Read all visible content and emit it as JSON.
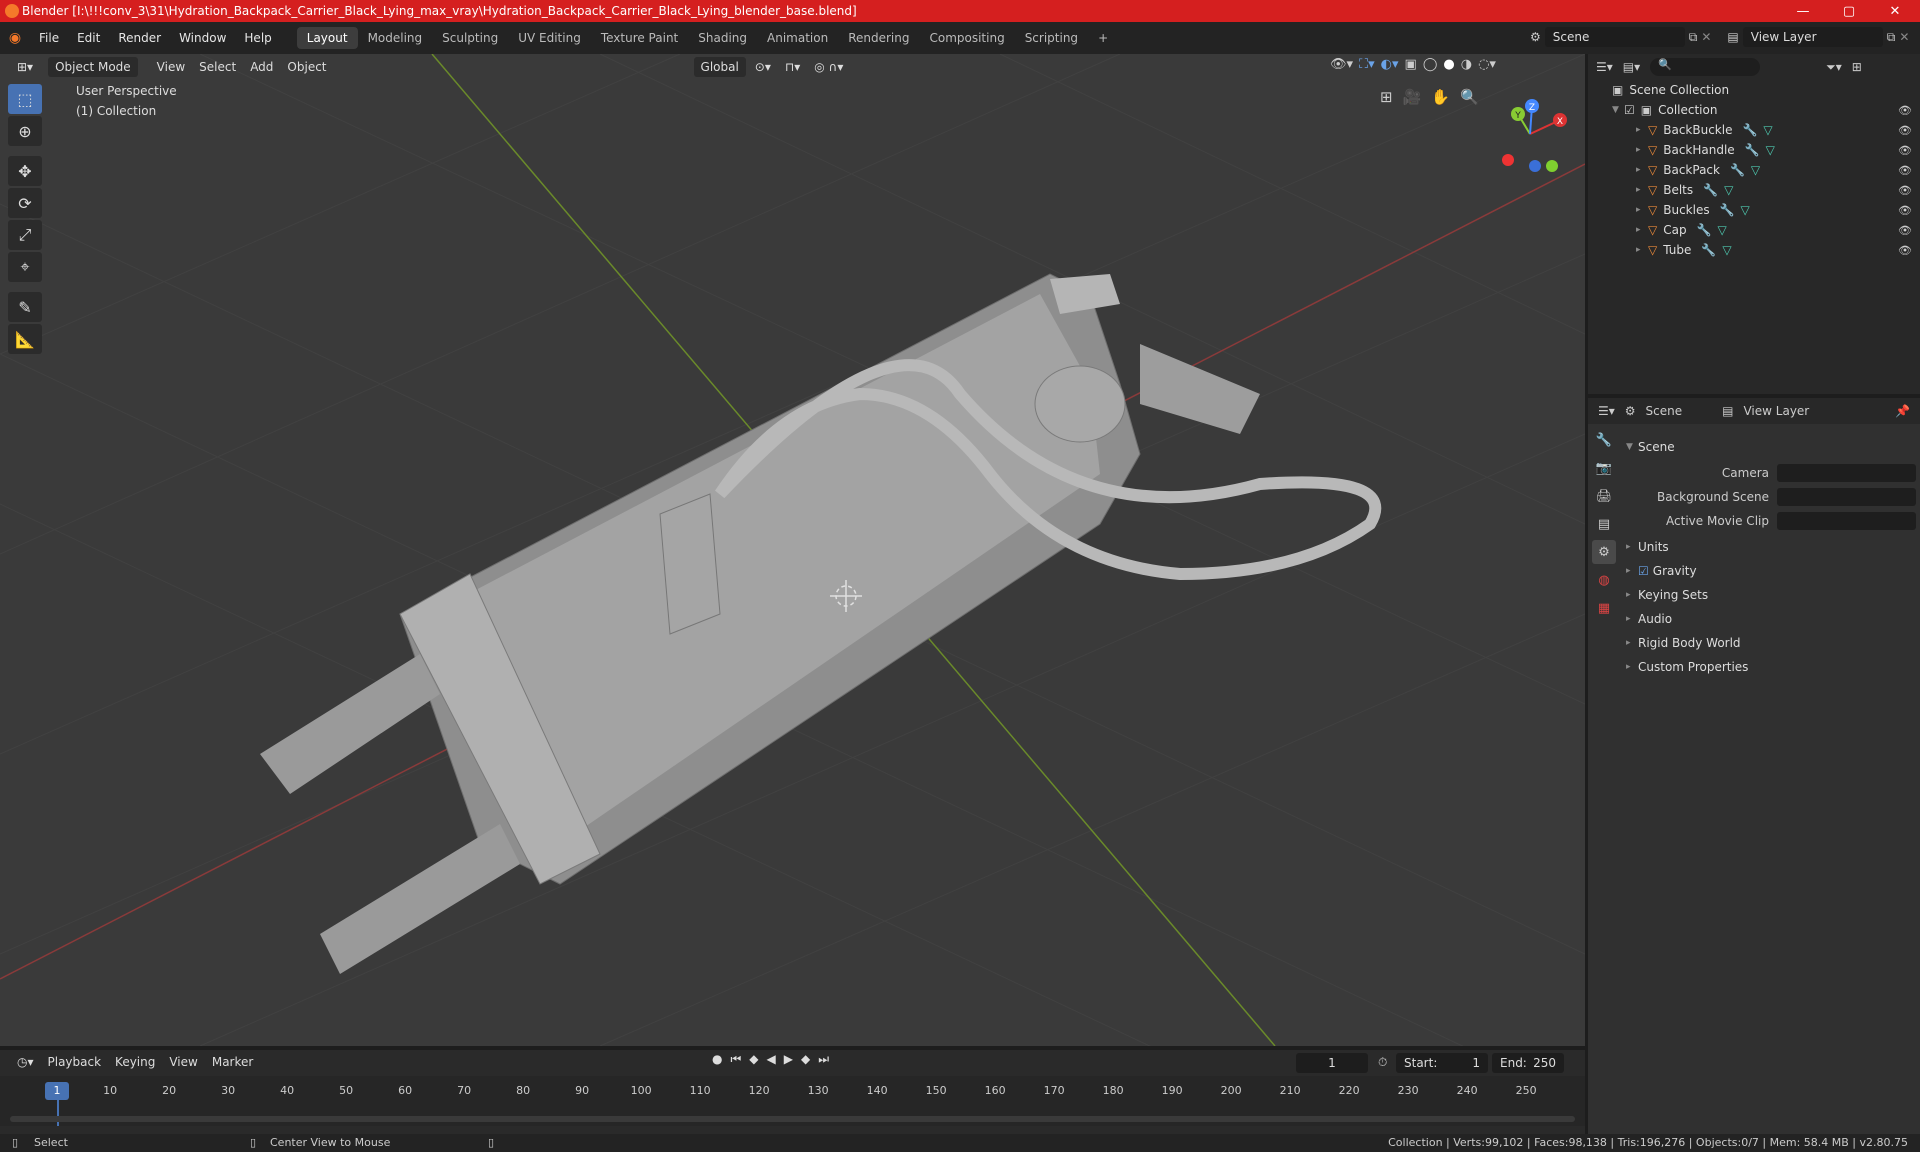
{
  "window": {
    "title": "Blender [I:\\!!!conv_3\\31\\Hydration_Backpack_Carrier_Black_Lying_max_vray\\Hydration_Backpack_Carrier_Black_Lying_blender_base.blend]",
    "min": "—",
    "max": "▢",
    "close": "✕"
  },
  "menus": [
    "File",
    "Edit",
    "Render",
    "Window",
    "Help"
  ],
  "workspaces": [
    "Layout",
    "Modeling",
    "Sculpting",
    "UV Editing",
    "Texture Paint",
    "Shading",
    "Animation",
    "Rendering",
    "Compositing",
    "Scripting"
  ],
  "scene_field": "Scene",
  "view_layer_field": "View Layer",
  "viewport": {
    "mode": "Object Mode",
    "menus": [
      "View",
      "Select",
      "Add",
      "Object"
    ],
    "orientation": "Global",
    "perspective": "User Perspective",
    "collection": "(1) Collection"
  },
  "gizmo": {
    "x": "X",
    "y": "Y",
    "z": "Z"
  },
  "outliner": {
    "root": "Scene Collection",
    "collection": "Collection",
    "objects": [
      "BackBuckle",
      "BackHandle",
      "BackPack",
      "Belts",
      "Buckles",
      "Cap",
      "Tube"
    ]
  },
  "properties": {
    "tab_scene": "Scene",
    "tab_view_layer": "View Layer",
    "section": "Scene",
    "camera": "Camera",
    "background_scene": "Background Scene",
    "active_movie_clip": "Active Movie Clip",
    "subsections": [
      "Units",
      "Gravity",
      "Keying Sets",
      "Audio",
      "Rigid Body World",
      "Custom Properties"
    ]
  },
  "timeline": {
    "menus": [
      "Playback",
      "Keying",
      "View",
      "Marker"
    ],
    "current_frame": "1",
    "start_label": "Start:",
    "start": "1",
    "end_label": "End:",
    "end": "250",
    "ticks": [
      "1",
      "10",
      "20",
      "30",
      "40",
      "50",
      "60",
      "70",
      "80",
      "90",
      "100",
      "110",
      "120",
      "130",
      "140",
      "150",
      "160",
      "170",
      "180",
      "190",
      "200",
      "210",
      "220",
      "230",
      "240",
      "250"
    ]
  },
  "status": {
    "left": "Select",
    "mid": "Center View to Mouse",
    "right": "Collection | Verts:99,102 | Faces:98,138 | Tris:196,276 | Objects:0/7 | Mem: 58.4 MB | v2.80.75"
  }
}
